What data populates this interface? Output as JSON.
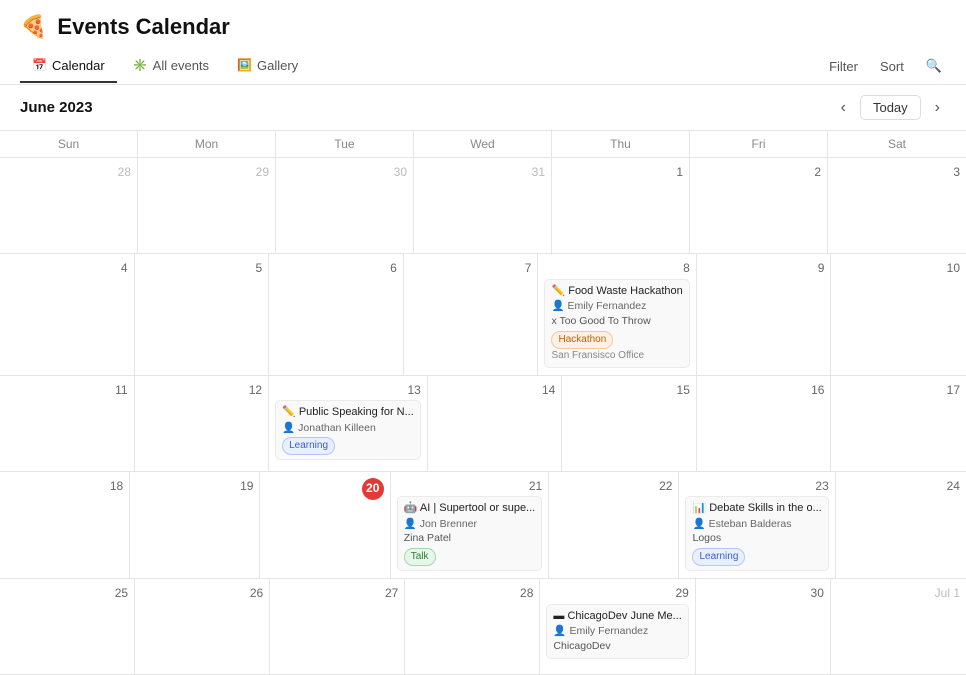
{
  "app": {
    "logo": "🍕",
    "title": "Events Calendar"
  },
  "nav": {
    "tabs": [
      {
        "id": "calendar",
        "label": "Calendar",
        "icon": "📅",
        "active": true
      },
      {
        "id": "all-events",
        "label": "All events",
        "icon": "✳️",
        "active": false
      },
      {
        "id": "gallery",
        "label": "Gallery",
        "icon": "🖼️",
        "active": false
      }
    ],
    "actions": [
      {
        "id": "filter",
        "label": "Filter"
      },
      {
        "id": "sort",
        "label": "Sort"
      },
      {
        "id": "search",
        "label": "🔍"
      }
    ]
  },
  "calendar": {
    "month_title": "June 2023",
    "today_label": "Today",
    "days_header": [
      "Sun",
      "Mon",
      "Tue",
      "Wed",
      "Thu",
      "Fri",
      "Sat"
    ],
    "weeks": [
      {
        "days": [
          {
            "num": "28",
            "other_month": true,
            "events": []
          },
          {
            "num": "29",
            "other_month": true,
            "events": []
          },
          {
            "num": "30",
            "other_month": true,
            "events": []
          },
          {
            "num": "31",
            "other_month": true,
            "events": []
          },
          {
            "num": "Jun 1",
            "display_num": "1",
            "events": []
          },
          {
            "num": "2",
            "events": []
          },
          {
            "num": "3",
            "events": []
          }
        ]
      },
      {
        "days": [
          {
            "num": "4",
            "events": []
          },
          {
            "num": "5",
            "events": []
          },
          {
            "num": "6",
            "events": []
          },
          {
            "num": "7",
            "events": []
          },
          {
            "num": "8",
            "events": [
              {
                "icon": "✏️",
                "title": "Food Waste Hackathon",
                "host_icon": "👤",
                "host": "Emily Fernandez",
                "org": "x Too Good To Throw",
                "tag": "Hackathon",
                "tag_class": "tag-hackathon",
                "location": "San Fransisco Office"
              }
            ]
          },
          {
            "num": "9",
            "events": []
          },
          {
            "num": "10",
            "events": []
          }
        ]
      },
      {
        "days": [
          {
            "num": "11",
            "events": []
          },
          {
            "num": "12",
            "events": []
          },
          {
            "num": "13",
            "events": [
              {
                "icon": "✏️",
                "title": "Public Speaking for N...",
                "host_icon": "👤",
                "host": "Jonathan Killeen",
                "tag": "Learning",
                "tag_class": "tag-learning"
              }
            ]
          },
          {
            "num": "14",
            "events": []
          },
          {
            "num": "15",
            "events": []
          },
          {
            "num": "16",
            "events": []
          },
          {
            "num": "17",
            "events": []
          }
        ]
      },
      {
        "days": [
          {
            "num": "18",
            "events": []
          },
          {
            "num": "19",
            "events": []
          },
          {
            "num": "20",
            "today": true,
            "events": []
          },
          {
            "num": "21",
            "events": [
              {
                "icon": "🤖",
                "title": "AI | Supertool or supe...",
                "host_icon": "👤",
                "host": "Jon Brenner",
                "org": "Zina Patel",
                "tag": "Talk",
                "tag_class": "tag-talk"
              }
            ]
          },
          {
            "num": "22",
            "events": []
          },
          {
            "num": "23",
            "events": [
              {
                "icon": "📊",
                "title": "Debate Skills in the o...",
                "host_icon": "👤",
                "host": "Esteban Balderas",
                "org": "Logos",
                "tag": "Learning",
                "tag_class": "tag-learning"
              }
            ]
          },
          {
            "num": "24",
            "events": []
          }
        ]
      },
      {
        "days": [
          {
            "num": "25",
            "events": []
          },
          {
            "num": "26",
            "events": []
          },
          {
            "num": "27",
            "events": []
          },
          {
            "num": "28",
            "events": []
          },
          {
            "num": "29",
            "events": [
              {
                "icon": "▬",
                "title": "ChicagoDev June Me...",
                "host_icon": "👤",
                "host": "Emily Fernandez",
                "org": "ChicagoDev"
              }
            ]
          },
          {
            "num": "30",
            "events": []
          },
          {
            "num": "Jul 1",
            "display_num": "Jul 1",
            "other_month": true,
            "events": []
          }
        ]
      }
    ]
  }
}
